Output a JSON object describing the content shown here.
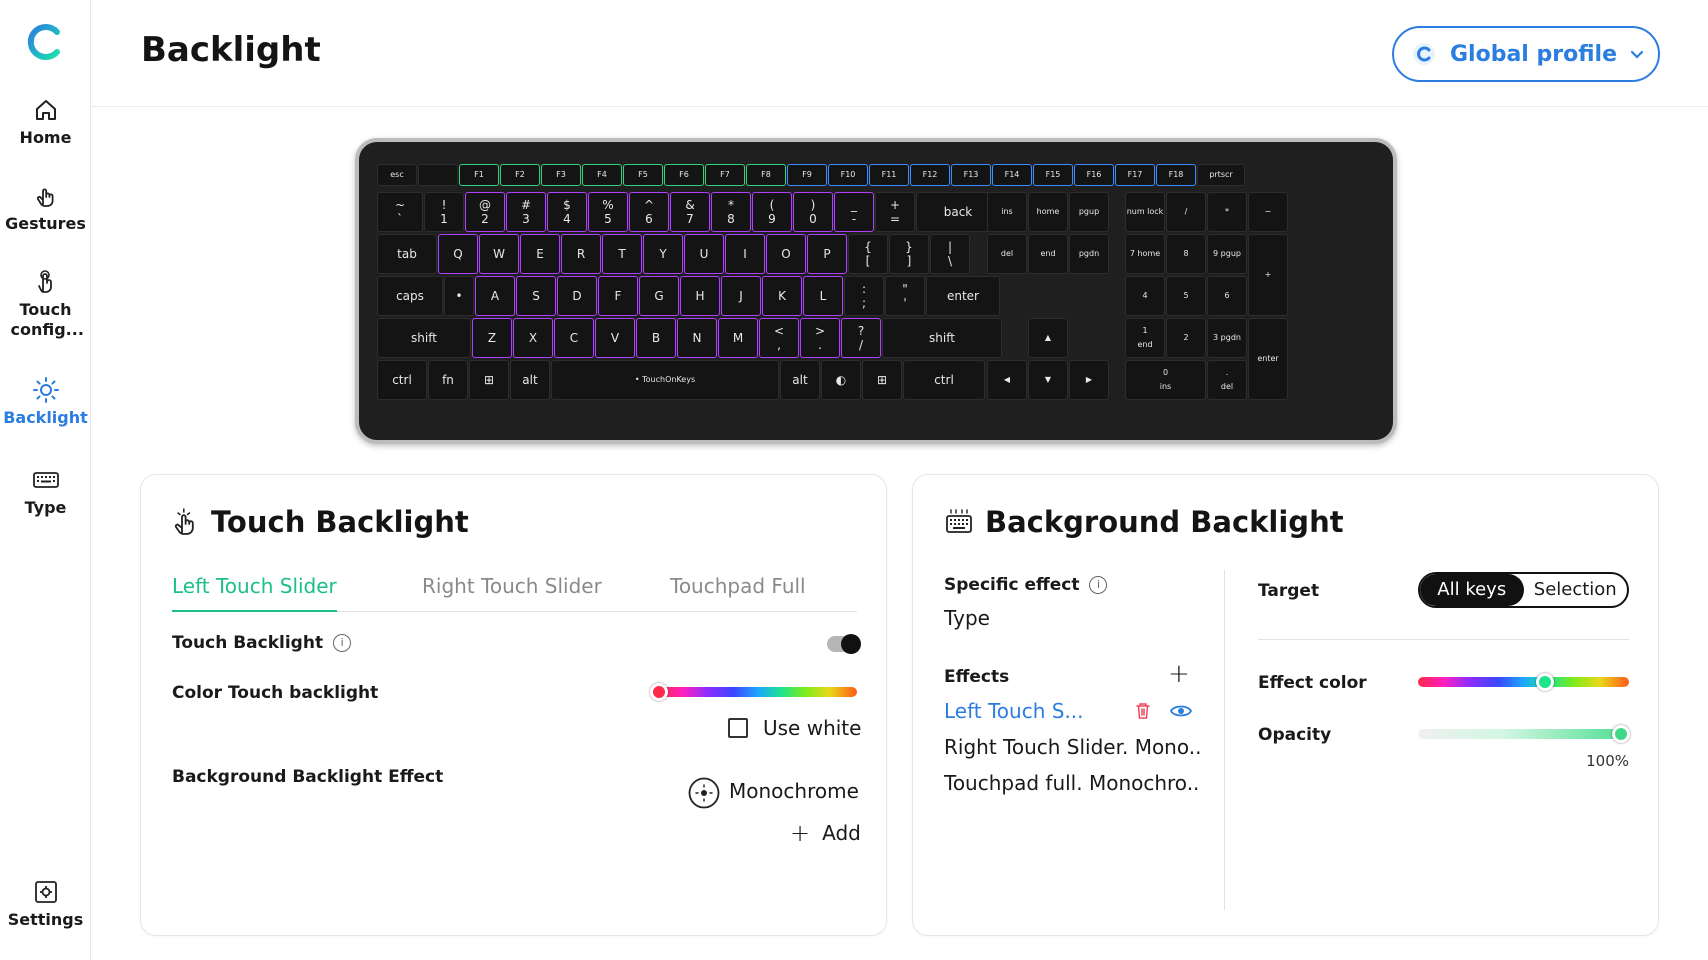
{
  "sidebar": {
    "items": [
      {
        "label": "Home",
        "icon": "home-icon"
      },
      {
        "label": "Gestures",
        "icon": "hand-icon"
      },
      {
        "label": "Touch config...",
        "icon": "touch-icon"
      },
      {
        "label": "Backlight",
        "icon": "sun-icon",
        "active": true
      },
      {
        "label": "Type",
        "icon": "keyboard-icon"
      }
    ],
    "settings_label": "Settings"
  },
  "header": {
    "title": "Backlight",
    "profile_label": "Global profile"
  },
  "colors": {
    "accent_blue": "#2b7de0",
    "accent_green": "#1bbf8a",
    "key_border_green": "#2fd37a",
    "key_border_blue": "#3a8eff",
    "key_border_purple": "#b040ff"
  },
  "keyboard": {
    "rows": [
      [
        "esc",
        "",
        "F1",
        "F2",
        "F3",
        "F4",
        "F5",
        "F6",
        "F7",
        "F8",
        "F9",
        "F10",
        "F11",
        "F12",
        "F13",
        "F14",
        "F15",
        "F16",
        "F17",
        "F18",
        "prtscr"
      ],
      [
        "~ `",
        "! 1",
        "@ 2",
        "# 3",
        "$ 4",
        "% 5",
        "^ 6",
        "& 7",
        "* 8",
        "( 9",
        ") 0",
        "_ -",
        "+ =",
        "back"
      ],
      [
        "tab",
        "Q",
        "W",
        "E",
        "R",
        "T",
        "Y",
        "U",
        "I",
        "O",
        "P",
        "{ [",
        "} ]",
        "| \\"
      ],
      [
        "caps",
        "•",
        "A",
        "S",
        "D",
        "F",
        "G",
        "H",
        "J",
        "K",
        "L",
        ": ;",
        "\" '",
        "enter"
      ],
      [
        "shift",
        "Z",
        "X",
        "C",
        "V",
        "B",
        "N",
        "M",
        "< ,",
        "> .",
        "? /",
        "shift"
      ],
      [
        "ctrl",
        "fn",
        "⊞",
        "alt",
        "• TouchOnKeys",
        "alt",
        "◐",
        "⊞",
        "ctrl"
      ]
    ],
    "nav": [
      "ins",
      "home",
      "pgup",
      "del",
      "end",
      "pgdn"
    ],
    "numpad": [
      "num lock",
      "/",
      "*",
      "−",
      "7 home",
      "8",
      "9 pgup",
      "+",
      "4",
      "5",
      "6",
      "1 end",
      "2",
      "3 pgdn",
      "enter",
      "0 ins",
      ". del"
    ]
  },
  "touch_backlight": {
    "title": "Touch Backlight",
    "tabs": [
      "Left Touch Slider",
      "Right Touch Slider",
      "Touchpad Full"
    ],
    "active_tab": 0,
    "toggle_label": "Touch Backlight",
    "toggle_on": true,
    "color_label": "Color Touch backlight",
    "color_value": 0.0,
    "use_white_label": "Use white",
    "use_white_checked": false,
    "bg_effect_label": "Background Backlight Effect",
    "bg_effect_value": "Monochrome",
    "add_label": "Add"
  },
  "background_backlight": {
    "title": "Background Backlight",
    "specific_effect_label": "Specific effect",
    "specific_effect_value": "Type",
    "effects_label": "Effects",
    "effects": [
      "Left Touch S...",
      "Right Touch Slider. Mono..",
      "Touchpad full. Monochro.."
    ],
    "target_label": "Target",
    "target_options": [
      "All keys",
      "Selection"
    ],
    "target_selected": 0,
    "effect_color_label": "Effect color",
    "effect_color_value": 0.6,
    "opacity_label": "Opacity",
    "opacity_value": "100%"
  }
}
